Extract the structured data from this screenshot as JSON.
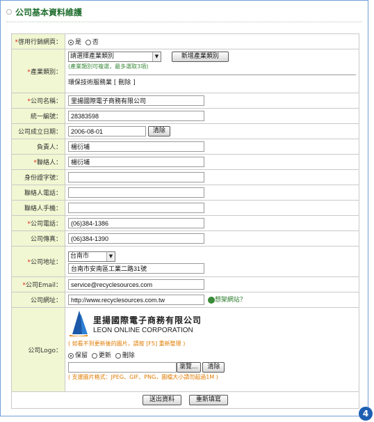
{
  "header": {
    "title": "公司基本資料維護"
  },
  "form": {
    "enable_site": {
      "label": "啓用行銷網頁：",
      "yes": "是",
      "no": "否"
    },
    "industry": {
      "label": "產業類別：",
      "select_value": "請選擇產業類別",
      "add_button": "新增產業類別",
      "hint": "(產業類別可複選，最多選取3項)",
      "selected_item": "環保技術服務業 [ 刪除 ]"
    },
    "company_name": {
      "label": "公司名稱：",
      "value": "里揚國際電子商務有限公司"
    },
    "tax_id": {
      "label": "統一編號：",
      "value": "28383598"
    },
    "founded": {
      "label": "公司成立日期：",
      "value": "2006-08-01",
      "clear_button": "清除"
    },
    "owner": {
      "label": "負責人：",
      "value": "楊衍埔"
    },
    "contact": {
      "label": "聯絡人：",
      "value": "楊衍埔"
    },
    "id_no": {
      "label": "身份證字號：",
      "value": ""
    },
    "contact_phone": {
      "label": "聯絡人電話：",
      "value": ""
    },
    "contact_mobile": {
      "label": "聯絡人手機：",
      "value": ""
    },
    "company_phone": {
      "label": "公司電話：",
      "value": "(06)384-1386"
    },
    "company_fax": {
      "label": "公司傳真：",
      "value": "(06)384-1390"
    },
    "address": {
      "label": "公司地址：",
      "city": "台南市",
      "value": "台南市安南區工業二路31號"
    },
    "email": {
      "label": "公司Email：",
      "value": "service@recyclesources.com"
    },
    "website": {
      "label": "公司網址：",
      "value": "http://www.recyclesources.com.tw",
      "link": "想架網站？"
    },
    "logo": {
      "label": "公司Logo：",
      "company_cn": "里揚國際電子商務有限公司",
      "company_en": "LEON ONLINE CORPORATION",
      "refresh_hint": "( 如看不到更新後的圖片，請按 [F5] 重新整理 )",
      "keep": "保留",
      "update": "更新",
      "delete": "刪除",
      "browse_button": "瀏覽...",
      "clear_button": "清除",
      "format_hint": "( 支援圖片格式：JPEG、GIF、PNG，圖檔大小請勿超過1M )"
    }
  },
  "actions": {
    "submit": "送出資料",
    "reset": "重新填寫"
  },
  "badge": "4"
}
